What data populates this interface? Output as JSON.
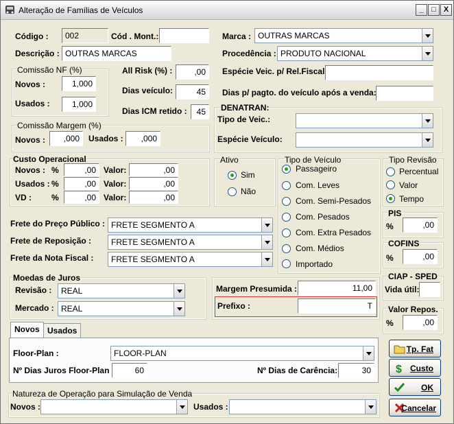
{
  "window": {
    "title": "Alteração de Famílias de Veículos",
    "btn_min": "_",
    "btn_max": "□",
    "btn_close": "X"
  },
  "codigo": {
    "label": "Código :",
    "value": "002"
  },
  "cod_mont": {
    "label": "Cód . Mont.:",
    "value": ""
  },
  "marca": {
    "label": "Marca :",
    "value": "OUTRAS MARCAS"
  },
  "descricao": {
    "label": "Descrição :",
    "value": "OUTRAS MARCAS"
  },
  "procedencia": {
    "label": "Procedência :",
    "value": "PRODUTO NACIONAL"
  },
  "comissao_nf": {
    "title": "Comissão NF (%)",
    "novos_label": "Novos :",
    "novos": "1,000",
    "usados_label": "Usados :",
    "usados": "1,000"
  },
  "all_risk": {
    "label": "All Risk (%) :",
    "value": ",00"
  },
  "dias_veiculo": {
    "label": "Dias veículo:",
    "value": "45"
  },
  "dias_icm": {
    "label": "Dias ICM retido :",
    "value": "45"
  },
  "especie_fiscal": {
    "label": "Espécie Veic. p/ Rel.Fiscal:",
    "value": ""
  },
  "dias_pagto": {
    "label": "Dias p/ pagto. do veículo após a venda:",
    "value": ""
  },
  "denatran": {
    "title": "DENATRAN:",
    "tipo_label": "Tipo de Veic.:",
    "tipo": "",
    "especie_label": "Espécie Veículo:",
    "especie": ""
  },
  "comissao_margem": {
    "title": "Comissão Margem (%)",
    "novos_label": "Novos :",
    "novos": ",000",
    "usados_label": "Usados :",
    "usados": ",000"
  },
  "custo": {
    "title": "Custo Operacional",
    "rows": [
      {
        "label": "Novos :",
        "pct": "%",
        "pct_value": ",00",
        "valor_label": "Valor:",
        "valor": ",00"
      },
      {
        "label": "Usados :",
        "pct": "%",
        "pct_value": ",00",
        "valor_label": "Valor:",
        "valor": ",00"
      },
      {
        "label": "VD :",
        "pct": "%",
        "pct_value": ",00",
        "valor_label": "Valor:",
        "valor": ",00"
      }
    ]
  },
  "ativo": {
    "title": "Ativo",
    "options": [
      "Sim",
      "Não"
    ]
  },
  "tipo_veiculo": {
    "title": "Tipo de Veículo",
    "options": [
      "Passageiro",
      "Com. Leves",
      "Com. Semi-Pesados",
      "Com. Pesados",
      "Com. Extra Pesados",
      "Com. Médios",
      "Importado"
    ]
  },
  "tipo_revisao": {
    "title": "Tipo Revisão",
    "options": [
      "Percentual",
      "Valor",
      "Tempo"
    ]
  },
  "frete": {
    "publico_label": "Frete do Preço Público :",
    "publico": "FRETE SEGMENTO A",
    "reposicao_label": "Frete de Reposição :",
    "reposicao": "FRETE SEGMENTO A",
    "nota_label": "Frete da Nota Fiscal :",
    "nota": "FRETE SEGMENTO A"
  },
  "pis": {
    "title": "PIS",
    "pct": "%",
    "value": ",00"
  },
  "cofins": {
    "title": "COFINS",
    "pct": "%",
    "value": ",00"
  },
  "ciap": {
    "title": "CIAP - SPED",
    "vida_label": "Vida útil:",
    "vida": ""
  },
  "valor_repos": {
    "title": "Valor Repos.",
    "pct": "%",
    "value": ",00"
  },
  "moedas": {
    "title": "Moedas de Juros",
    "revisao_label": "Revisão :",
    "revisao": "REAL",
    "mercado_label": "Mercado :",
    "mercado": "REAL"
  },
  "margem": {
    "label": "Margem Presumida :",
    "value": "11,00"
  },
  "prefixo": {
    "label": "Prefixo :",
    "value": "T"
  },
  "tabs": {
    "novos": "Novos",
    "usados": "Usados"
  },
  "floor": {
    "label": "Floor-Plan :",
    "value": "FLOOR-PLAN",
    "juros_label": "Nº Dias Juros Floor-Plan :",
    "juros": "60",
    "carencia_label": "Nº Dias de Carência:",
    "carencia": "30"
  },
  "natureza": {
    "title": "Natureza de Operação para Simulação de Venda",
    "novos_label": "Novos :",
    "novos": "",
    "usados_label": "Usados :",
    "usados": ""
  },
  "buttons": {
    "tp_fat": "Tp. Fat",
    "custo": "Custo",
    "ok": "OK",
    "cancelar": "Cancelar"
  }
}
